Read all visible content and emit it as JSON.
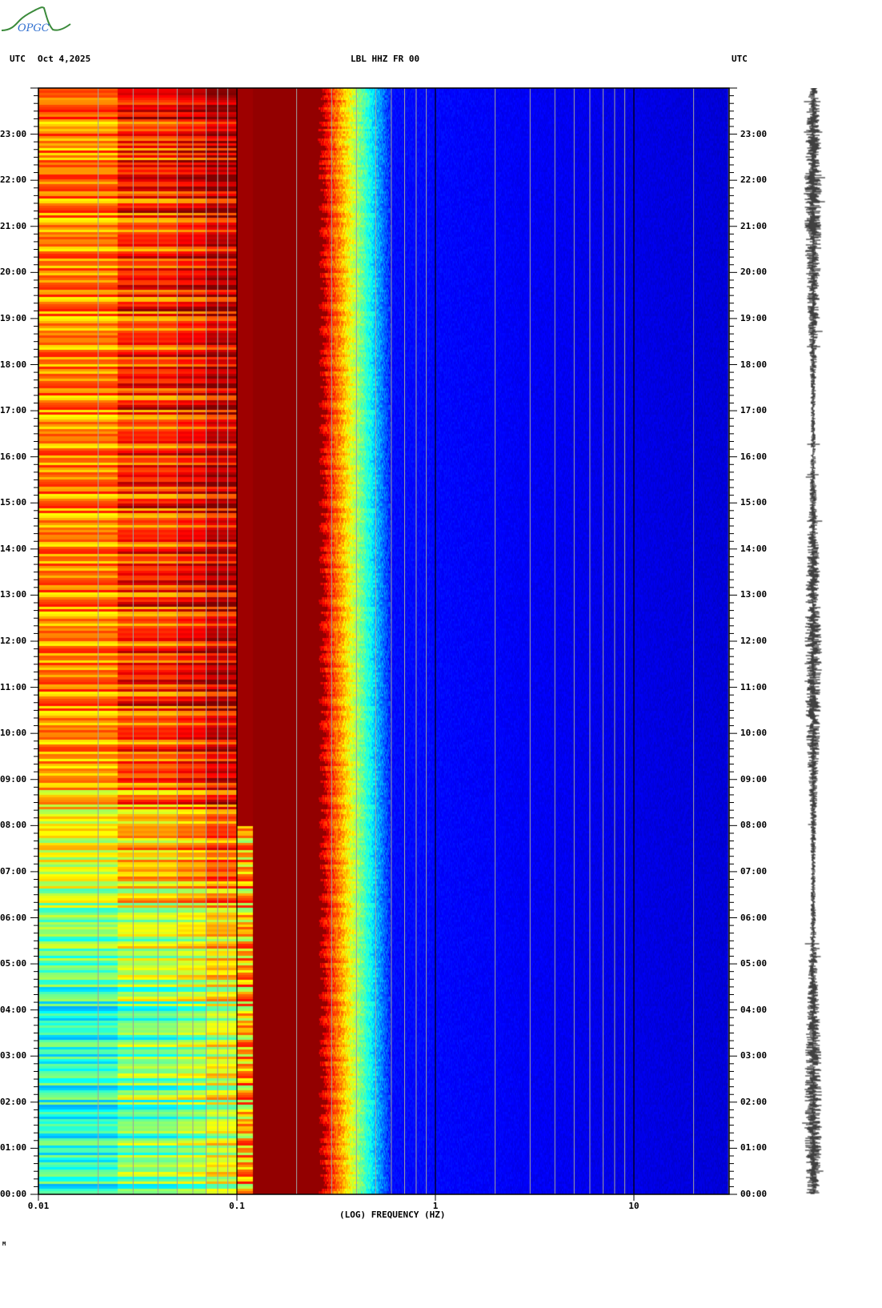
{
  "header": {
    "logo_text": "OPGC",
    "left_tz": "UTC",
    "date": "Oct 4,2025",
    "station": "LBL HHZ FR 00",
    "right_tz": "UTC"
  },
  "footer_mark": "M",
  "chart_data": {
    "type": "heatmap",
    "title": "LBL HHZ FR 00",
    "xlabel": "(LOG) FREQUENCY (HZ)",
    "ylabel": "UTC",
    "x_scale": "log",
    "xlim": [
      0.01,
      30
    ],
    "ylim_hours": [
      0,
      24
    ],
    "x_ticks": [
      "0.01",
      "0.1",
      "1",
      "10"
    ],
    "x_tick_values": [
      0.01,
      0.1,
      1,
      10
    ],
    "y_ticks": [
      "00:00",
      "01:00",
      "02:00",
      "03:00",
      "04:00",
      "05:00",
      "06:00",
      "07:00",
      "08:00",
      "09:00",
      "10:00",
      "11:00",
      "12:00",
      "13:00",
      "14:00",
      "15:00",
      "16:00",
      "17:00",
      "18:00",
      "19:00",
      "20:00",
      "21:00",
      "22:00",
      "23:00"
    ],
    "colormap": "jet",
    "features": [
      {
        "name": "low-frequency band",
        "freq_range_hz": [
          0.01,
          0.1
        ],
        "level": "high (yellow-red) 08:00-24:00, medium (cyan-green) 00:00-07:00"
      },
      {
        "name": "secondary microseism peak",
        "freq_range_hz": [
          0.12,
          0.27
        ],
        "level": "saturated (dark red) all day"
      },
      {
        "name": "roll-off",
        "freq_range_hz": [
          0.27,
          0.6
        ],
        "level": "red to cyan to blue"
      },
      {
        "name": "high frequency",
        "freq_range_hz": [
          1,
          30
        ],
        "level": "low (dark blue)"
      }
    ],
    "grid": true,
    "side_trace": "seismogram"
  }
}
